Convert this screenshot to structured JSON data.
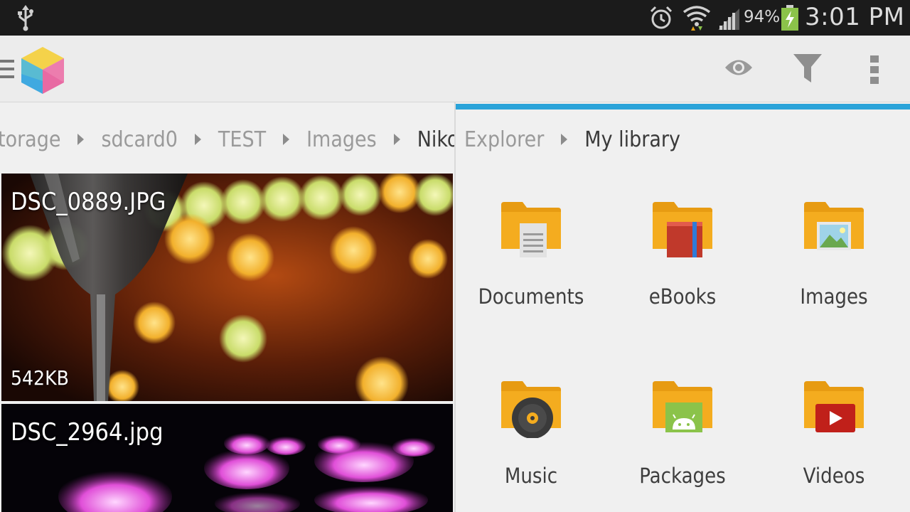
{
  "status_bar": {
    "battery_percent": "94%",
    "time": "3:01 PM",
    "icons": [
      "usb-icon",
      "alarm-icon",
      "wifi-icon",
      "signal-icon",
      "battery-charging-icon"
    ]
  },
  "action_bar": {
    "icons": [
      "menu-icon",
      "app-logo-icon",
      "eye-icon",
      "filter-icon",
      "overflow-menu-icon"
    ]
  },
  "left_pane": {
    "breadcrumb": [
      "torage",
      "sdcard0",
      "TEST",
      "Images",
      "Nikon"
    ],
    "files": [
      {
        "name": "DSC_0889.JPG",
        "size": "542KB"
      },
      {
        "name": "DSC_2964.jpg",
        "size": ""
      }
    ]
  },
  "right_pane": {
    "accent_color": "#2aa3d9",
    "breadcrumb": [
      "Explorer",
      "My library"
    ],
    "library": [
      {
        "label": "Documents",
        "icon": "documents-folder-icon"
      },
      {
        "label": "eBooks",
        "icon": "ebooks-folder-icon"
      },
      {
        "label": "Images",
        "icon": "images-folder-icon"
      },
      {
        "label": "Music",
        "icon": "music-folder-icon"
      },
      {
        "label": "Packages",
        "icon": "packages-folder-icon"
      },
      {
        "label": "Videos",
        "icon": "videos-folder-icon"
      }
    ]
  }
}
